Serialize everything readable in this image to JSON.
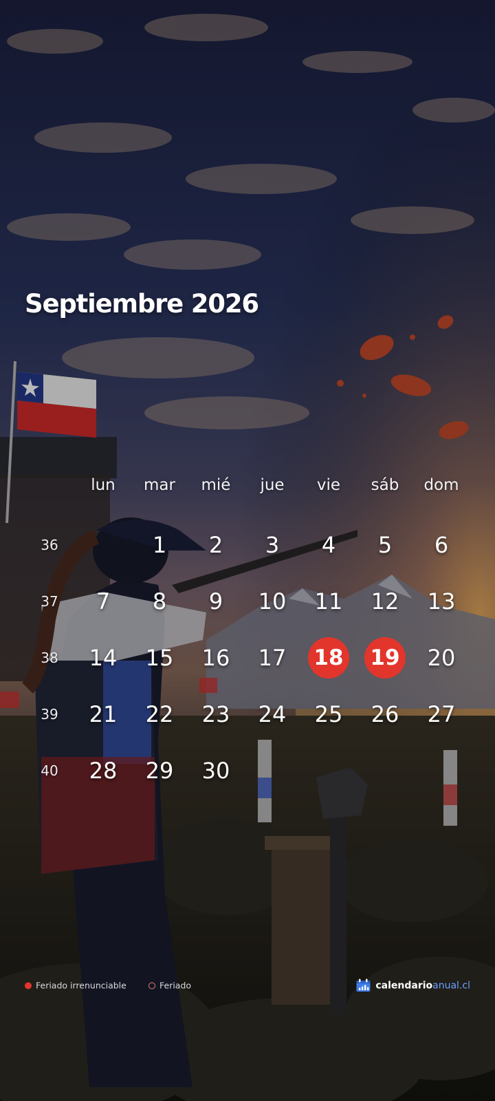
{
  "calendar": {
    "title": "Septiembre 2026",
    "weekdays": [
      "lun",
      "mar",
      "mié",
      "jue",
      "vie",
      "sáb",
      "dom"
    ],
    "weeks": [
      {
        "number": "36",
        "days": [
          "",
          "1",
          "2",
          "3",
          "4",
          "5",
          "6"
        ]
      },
      {
        "number": "37",
        "days": [
          "7",
          "8",
          "9",
          "10",
          "11",
          "12",
          "13"
        ]
      },
      {
        "number": "38",
        "days": [
          "14",
          "15",
          "16",
          "17",
          "18",
          "19",
          "20"
        ]
      },
      {
        "number": "39",
        "days": [
          "21",
          "22",
          "23",
          "24",
          "25",
          "26",
          "27"
        ]
      },
      {
        "number": "40",
        "days": [
          "28",
          "29",
          "30",
          "",
          "",
          "",
          ""
        ]
      }
    ],
    "holidays": [
      "18",
      "19"
    ]
  },
  "legend": {
    "irrenunciable_label": "Feriado irrenunciable",
    "feriado_label": "Feriado"
  },
  "brand": {
    "name_part1": "calendario",
    "name_part2": "anual.cl",
    "icon": "calendar-chart-icon"
  },
  "colors": {
    "holiday_fill": "#e2352c",
    "brand_accent": "#6fa2ff"
  }
}
